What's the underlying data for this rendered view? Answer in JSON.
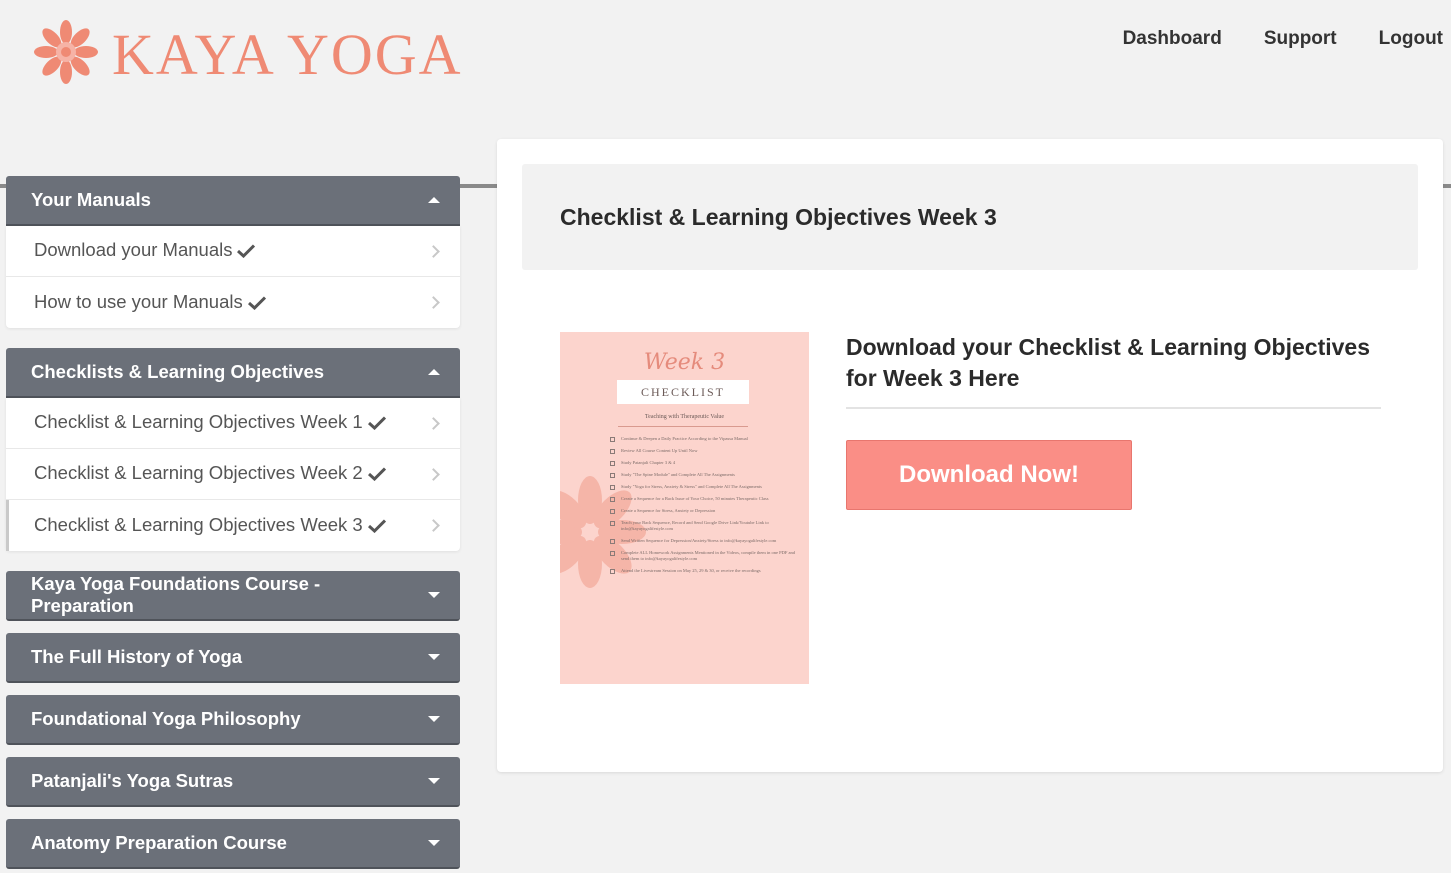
{
  "brand": {
    "name": "KAYA YOGA",
    "color": "#ef8a74",
    "icon": "lotus-mandala-icon"
  },
  "topnav": {
    "dashboard": "Dashboard",
    "support": "Support",
    "logout": "Logout"
  },
  "sidebar": {
    "sections": [
      {
        "title": "Your Manuals",
        "expanded": true,
        "items": [
          "Download your Manuals",
          "How to use your Manuals"
        ]
      },
      {
        "title": "Checklists & Learning Objectives",
        "expanded": true,
        "items": [
          "Checklist & Learning Objectives Week 1",
          "Checklist & Learning Objectives Week 2",
          "Checklist & Learning Objectives Week 3"
        ],
        "active_item": "Checklist & Learning Objectives Week 3"
      },
      {
        "title": "Kaya Yoga Foundations Course - Preparation",
        "expanded": false
      },
      {
        "title": "The Full History of Yoga",
        "expanded": false
      },
      {
        "title": "Foundational Yoga Philosophy",
        "expanded": false
      },
      {
        "title": "Patanjali's Yoga Sutras",
        "expanded": false
      },
      {
        "title": "Anatomy Preparation Course",
        "expanded": false
      }
    ]
  },
  "main": {
    "page_title": "Checklist & Learning Objectives Week 3",
    "thumbnail": {
      "week": "Week 3",
      "label": "CHECKLIST",
      "subtitle": "Teaching with Therapeutic Value",
      "items": [
        "Continue & Deepen a Daily Practice According to the Vipassa Manual",
        "Review All Course Content Up Until Now",
        "Study Patanjali Chapter 3 & 4",
        "Study \"The Spine Module\" and Complete All The Assignments",
        "Study \"Yoga for Stress, Anxiety & Stress\" and Complete All The Assignments",
        "Create a Sequence for a Back Issue of Your Choice, 50 minutes Therapeutic Class",
        "Create a Sequence for Stress, Anxiety or Depression",
        "Teach your Back Sequence, Record and Send Google Drive Link/Youtube Link to info@kayayogalifestyle.com",
        "Send Written Sequence for Depression/Anxiety/Stress to info@kayayogalifestyle.com",
        "Complete ALL Homework Assignments Mentioned in the Videos, compile them in one PDF and send them to info@kayayogalifestyle.com",
        "Attend the Livestream Session on May 25, 29 & 30, or receive the recordings"
      ]
    },
    "download_heading": "Download your Checklist & Learning Objectives for Week 3 Here",
    "download_button": "Download Now!",
    "button_color": "#fa8e86"
  }
}
